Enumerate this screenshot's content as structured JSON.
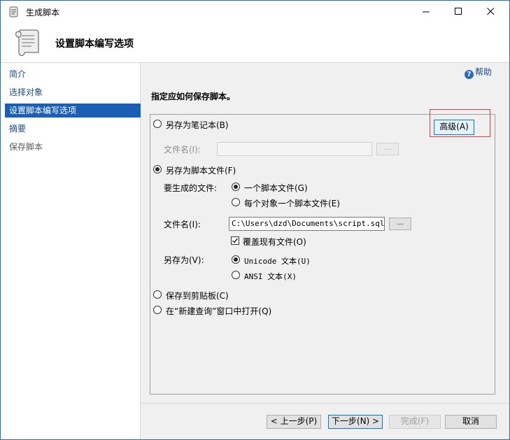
{
  "window": {
    "title": "生成脚本"
  },
  "header": {
    "title": "设置脚本编写选项"
  },
  "sidebar": {
    "items": [
      {
        "label": "简介"
      },
      {
        "label": "选择对象"
      },
      {
        "label": "设置脚本编写选项"
      },
      {
        "label": "摘要"
      },
      {
        "label": "保存脚本"
      }
    ]
  },
  "main": {
    "help_label": "帮助",
    "instruction": "指定应如何保存脚本。",
    "advanced_button": "高级(A)",
    "save_notebook": {
      "label": "另存为笔记本(B)",
      "filename_label": "文件名(I):",
      "browse": "..."
    },
    "save_script": {
      "label": "另存为脚本文件(F)",
      "files_to_generate_label": "要生成的文件:",
      "single_file": "一个脚本文件(G)",
      "per_object": "每个对象一个脚本文件(E)",
      "filename_label": "文件名(I):",
      "filename_value": "C:\\Users\\dzd\\Documents\\script.sql",
      "browse": "...",
      "overwrite": "覆盖现有文件(O)",
      "save_as_label": "另存为(V):",
      "unicode": "Unicode 文本(U)",
      "ansi": "ANSI 文本(X)"
    },
    "clipboard": "保存到剪贴板(C)",
    "new_query": "在“新建查询”窗口中打开(Q)"
  },
  "footer": {
    "prev": "< 上一步(P)",
    "next": "下一步(N) >",
    "finish": "完成(F)",
    "cancel": "取消"
  }
}
